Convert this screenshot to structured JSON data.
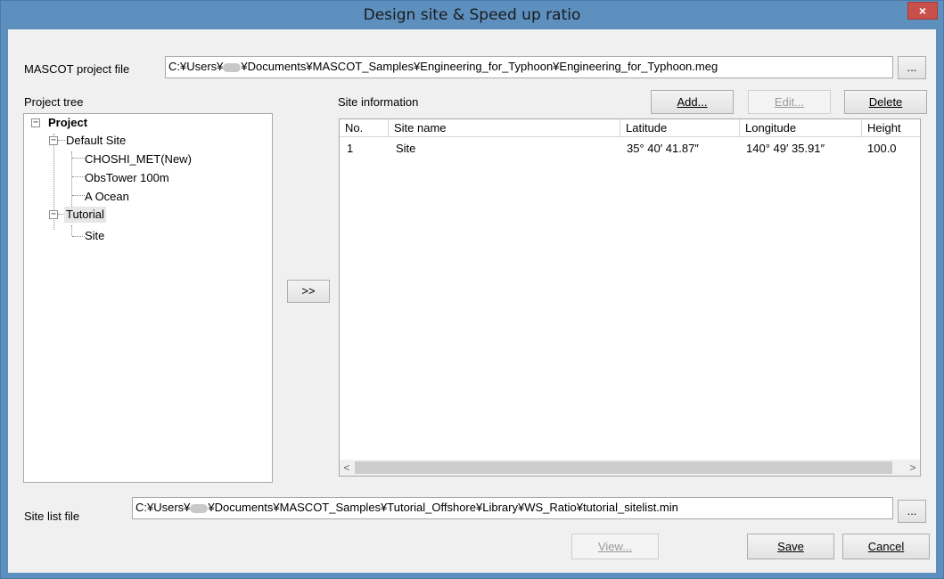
{
  "window": {
    "title": "Design site & Speed up ratio",
    "close_symbol": "×",
    "colors": {
      "titlebar": "#5d90bf",
      "close": "#c7504a",
      "client": "#f0f0f0"
    }
  },
  "project_file": {
    "label": "MASCOT project file",
    "path_prefix": "C:¥Users¥",
    "path_suffix": "¥Documents¥MASCOT_Samples¥Engineering_for_Typhoon¥Engineering_for_Typhoon.meg",
    "browse_label": "..."
  },
  "project_tree": {
    "label": "Project tree",
    "nodes": {
      "project": "Project",
      "default_site": "Default Site",
      "choshi": "CHOSHI_MET(New)",
      "obstower": "ObsTower 100m",
      "a_ocean": "A Ocean",
      "tutorial": "Tutorial",
      "site": "Site"
    },
    "toggle_symbol": "−"
  },
  "transfer_button": ">>",
  "site_info": {
    "label": "Site information",
    "add_label": "Add...",
    "edit_label": "Edit...",
    "delete_label": "Delete",
    "columns": [
      "No.",
      "Site name",
      "Latitude",
      "Longitude",
      "Height"
    ],
    "rows": [
      [
        "1",
        "Site",
        "35° 40′ 41.87″",
        "140° 49′ 35.91″",
        "100.0"
      ]
    ],
    "scroll_left": "<",
    "scroll_right": ">"
  },
  "site_list_file": {
    "label": "Site list file",
    "path_prefix": "C:¥Users¥",
    "path_suffix": "¥Documents¥MASCOT_Samples¥Tutorial_Offshore¥Library¥WS_Ratio¥tutorial_sitelist.min",
    "browse_label": "..."
  },
  "footer": {
    "view_label": "View...",
    "save_label": "Save",
    "cancel_label": "Cancel"
  }
}
